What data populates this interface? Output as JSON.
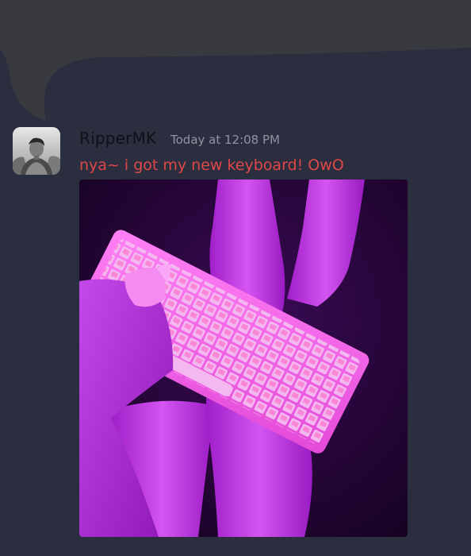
{
  "message": {
    "username": "RipperMK",
    "timestamp": "Today at 12:08 PM",
    "text": "nya~ i got my new keyboard! OwO",
    "text_color": "#e04848",
    "avatar_icon": "user-photo-avatar",
    "attachment_icon": "keyboard-photo"
  },
  "colors": {
    "background": "#2a2e3e",
    "bubble": "#383a40",
    "username": "#0f1117",
    "timestamp": "#8f93a2"
  }
}
